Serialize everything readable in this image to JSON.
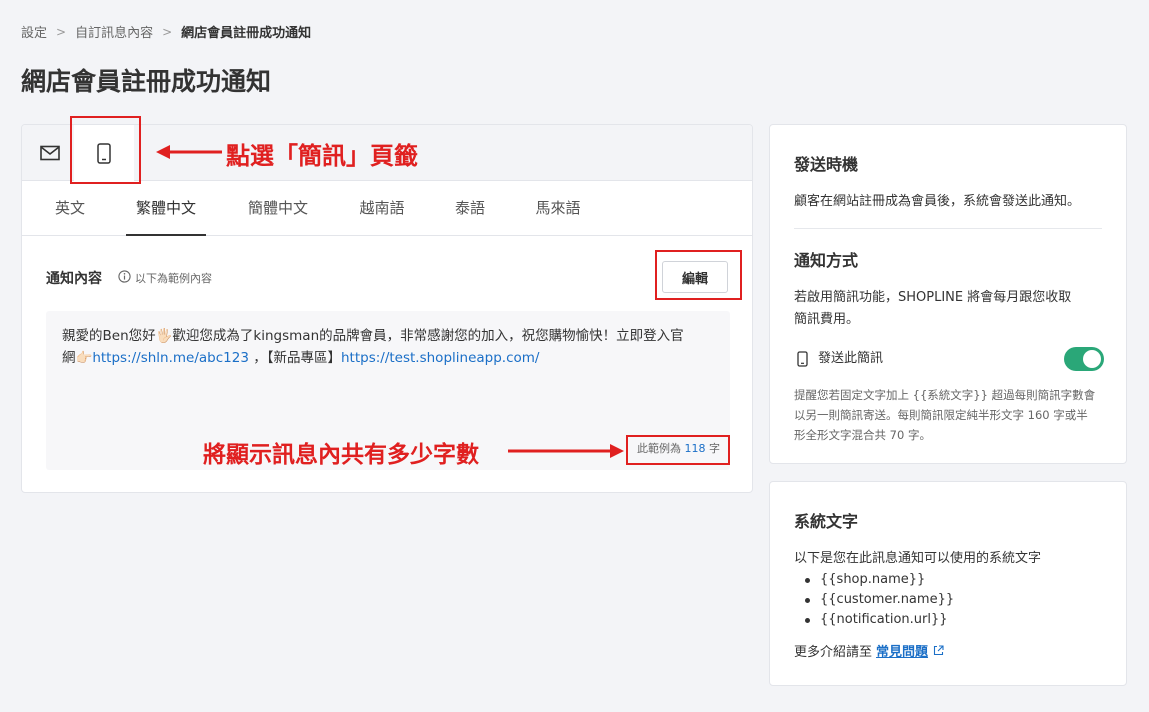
{
  "breadcrumb": {
    "items": [
      "設定",
      "自訂訊息內容",
      "網店會員註冊成功通知"
    ],
    "separator": ">"
  },
  "page": {
    "title": "網店會員註冊成功通知"
  },
  "channels": [
    {
      "name": "email",
      "icon": "mail-icon",
      "selected": false
    },
    {
      "name": "sms",
      "icon": "mobile-phone-icon",
      "selected": true
    }
  ],
  "language_tabs": [
    "英文",
    "繁體中文",
    "簡體中文",
    "越南語",
    "泰語",
    "馬來語"
  ],
  "active_language": "繁體中文",
  "content": {
    "label": "通知內容",
    "hint": "以下為範例內容",
    "edit_button": "編輯",
    "message_line1": "親愛的Ben您好🖐🏻歡迎您成為了kingsman的品牌會員，非常感謝您的加入，祝您購物愉快！立即登入官",
    "message_line2_prefix": "網👉🏻",
    "link1": "https://shln.me/abc123",
    "middle_text": " ，【新品專區】",
    "link2": "https://test.shoplineapp.com/",
    "count_prefix": "此範例為",
    "count_value": "118",
    "count_suffix": "字"
  },
  "sidebar": {
    "timing_title": "發送時機",
    "timing_text": "顧客在網站註冊成為會員後，系統會發送此通知。",
    "method_title": "通知方式",
    "method_text_line1": "若啟用簡訊功能，SHOPLINE 將會每月跟您收取",
    "method_text_line2": "簡訊費用。",
    "send_sms_label": "發送此簡訊",
    "send_sms_enabled": true,
    "note_line1": "提醒您若固定文字加上 {{系統文字}} 超過每則簡訊字數會",
    "note_line2": "以另一則簡訊寄送。每則簡訊限定純半形文字 160 字或半",
    "note_line3": "形全形文字混合共 70 字。"
  },
  "system_text": {
    "title": "系統文字",
    "intro": "以下是您在此訊息通知可以使用的系統文字",
    "items": [
      "{{shop.name}}",
      "{{customer.name}}",
      "{{notification.url}}"
    ],
    "more_prefix": "更多介紹請至",
    "faq_link": "常見問題"
  },
  "annotations": {
    "tab_instruction": "點選「簡訊」頁籤",
    "count_instruction": "將顯示訊息內共有多少字數"
  },
  "colors": {
    "annotation": "#e02020",
    "link": "#1b6fc7",
    "toggle_on": "#2aa778"
  }
}
